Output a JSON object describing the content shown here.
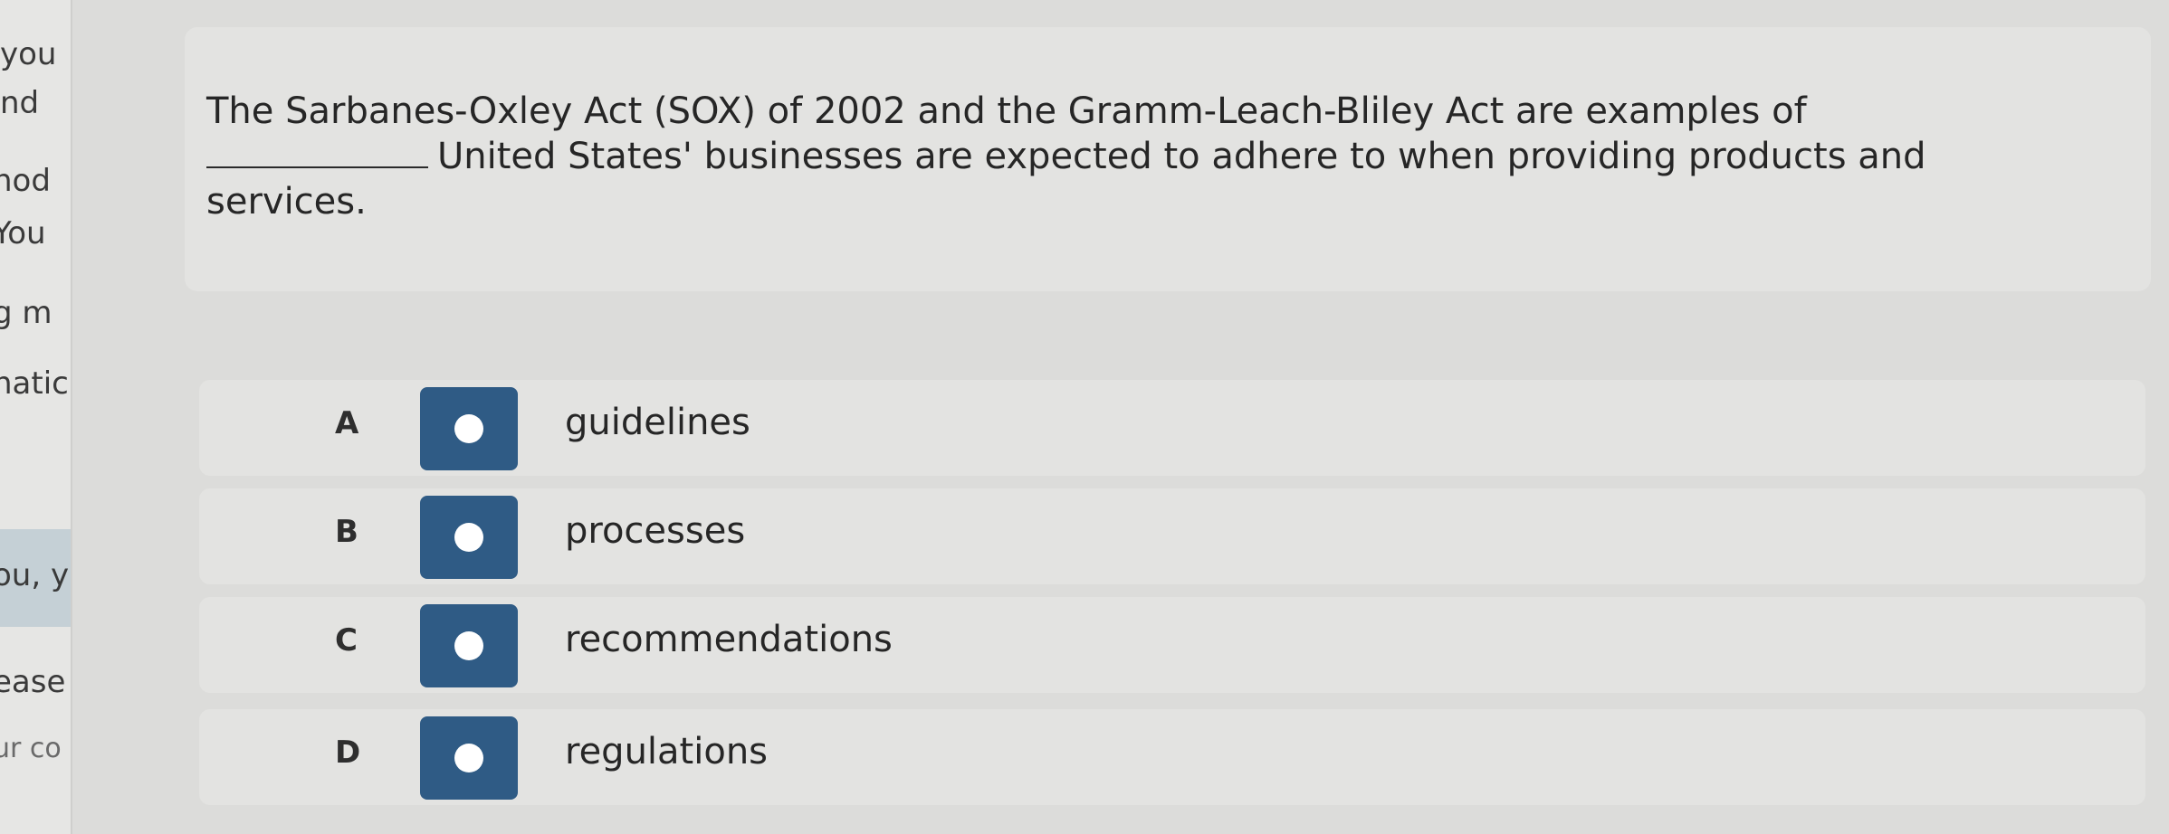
{
  "sidebar_fragments": [
    "you",
    "nd",
    "nod",
    "You",
    "g m",
    "natic",
    "ou, y",
    "ease",
    "ur co"
  ],
  "question": {
    "part1": "The Sarbanes-Oxley Act (SOX) of 2002 and the Gramm-Leach-Bliley Act are examples of",
    "part2": "United States' businesses are expected to adhere to when providing products and services."
  },
  "options": [
    {
      "letter": "A",
      "label": "guidelines"
    },
    {
      "letter": "B",
      "label": "processes"
    },
    {
      "letter": "C",
      "label": "recommendations"
    },
    {
      "letter": "D",
      "label": "regulations"
    }
  ],
  "colors": {
    "radio_bg": "#2f5b85",
    "card_bg": "#e3e3e1",
    "page_bg": "#dcdcda"
  }
}
